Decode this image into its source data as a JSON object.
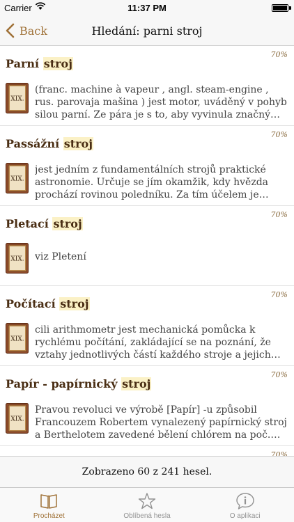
{
  "status_bar": {
    "carrier": "Carrier",
    "time": "11:37 PM"
  },
  "nav": {
    "back_label": "Back",
    "title": "Hledání: parni stroj"
  },
  "results": [
    {
      "title_before": "Parní ",
      "title_highlight": "stroj",
      "score": "70%",
      "icon_text": "XIX.",
      "excerpt": "(franc. machine à vapeur , angl. steam-engine , rus. parovaja mašina ) jest motor, uváděný v pohyb silou parní. Ze pára je s to, aby vyvinula značný tlak, byla zkušenost zajisté velmi stará"
    },
    {
      "title_before": "Passážní ",
      "title_highlight": "stroj",
      "score": "70%",
      "icon_text": "XIX.",
      "excerpt": "jest jedním z fundamentálních strojů praktické astronomie. Určuje se jím okamžik, kdy hvězda prochází rovinou poledníku. Za tím účelem je zřízen dalekohled"
    },
    {
      "title_before": "Pletací ",
      "title_highlight": "stroj",
      "score": "70%",
      "icon_text": "XIX.",
      "excerpt": "viz Pletení"
    },
    {
      "title_before": "Počítací ",
      "title_highlight": "stroj",
      "score": "70%",
      "icon_text": "XIX.",
      "excerpt": "cili arithmometr jest mechanická pomůcka k rychlému počítání, zakládající se na poznání, že vztahy jednotlivých částí každého stroje a jejich pohybů"
    },
    {
      "title_before": "Papír - papírnický ",
      "title_highlight": "stroj",
      "score": "70%",
      "icon_text": "XIX.",
      "excerpt": "Pravou revoluci ve výrobě [Papír] -u způsobil Francouzem Robertem vynalezený papírnický stroj a Berthelotem zavedené bělení chlórem na poč. století"
    },
    {
      "title_before": "",
      "title_highlight": "",
      "score": "70%",
      "icon_text": "",
      "excerpt": ""
    }
  ],
  "footer": {
    "count_text": "Zobrazeno 60 z 241 hesel."
  },
  "tabs": [
    {
      "label": "Procházet",
      "icon": "book-icon"
    },
    {
      "label": "Oblíbená hesla",
      "icon": "star-icon"
    },
    {
      "label": "O aplikaci",
      "icon": "info-icon"
    }
  ],
  "colors": {
    "accent": "#a07238",
    "title": "#4a2e14",
    "highlight": "#fbf1c6",
    "book": "#8e4b2a"
  }
}
